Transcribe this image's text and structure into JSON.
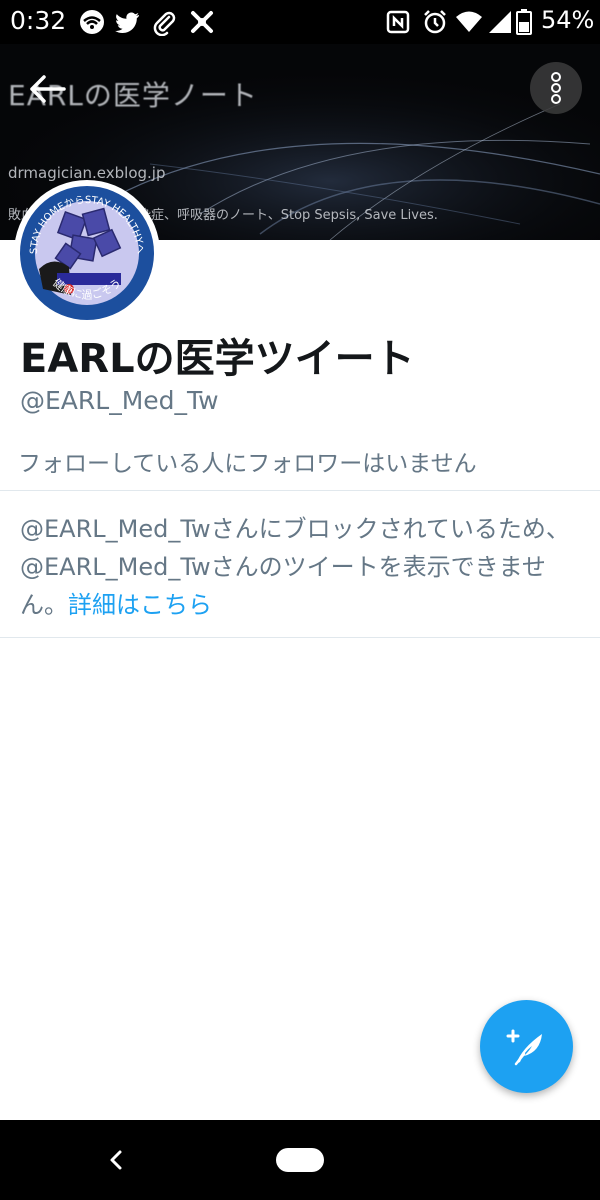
{
  "status_bar": {
    "time": "0:32",
    "battery_percent": "54%",
    "left_icons": [
      "wifi-hotspot-icon",
      "twitter-bird-icon",
      "paperclip-icon",
      "app-x-icon"
    ],
    "right_icons": [
      "nfc-icon",
      "alarm-icon",
      "wifi-signal-icon",
      "cell-signal-icon",
      "battery-icon"
    ]
  },
  "banner": {
    "title": "EARLの医学ノート",
    "url": "drmagician.exblog.jp",
    "tagline": "敗血症、集中治療、感染症、呼吸器のノート、Stop Sepsis, Save Lives."
  },
  "avatar": {
    "ring_text_top": "STAY HOMEからSTAY HEALTHYへ",
    "ring_text_bottom": "健康に過ごそう"
  },
  "profile": {
    "name": "EARLの医学ツイート",
    "handle": "@EARL_Med_Tw",
    "follow_note": "フォローしている人にフォロワーはいません"
  },
  "blocked": {
    "message": "@EARL_Med_Twさんにブロックされているため、@EARL_Med_Twさんのツイートを表示できません。",
    "link_text": "詳細はこちら"
  },
  "colors": {
    "accent": "#1da1f2",
    "secondary_text": "#657786",
    "divider": "#e1e8ed"
  }
}
